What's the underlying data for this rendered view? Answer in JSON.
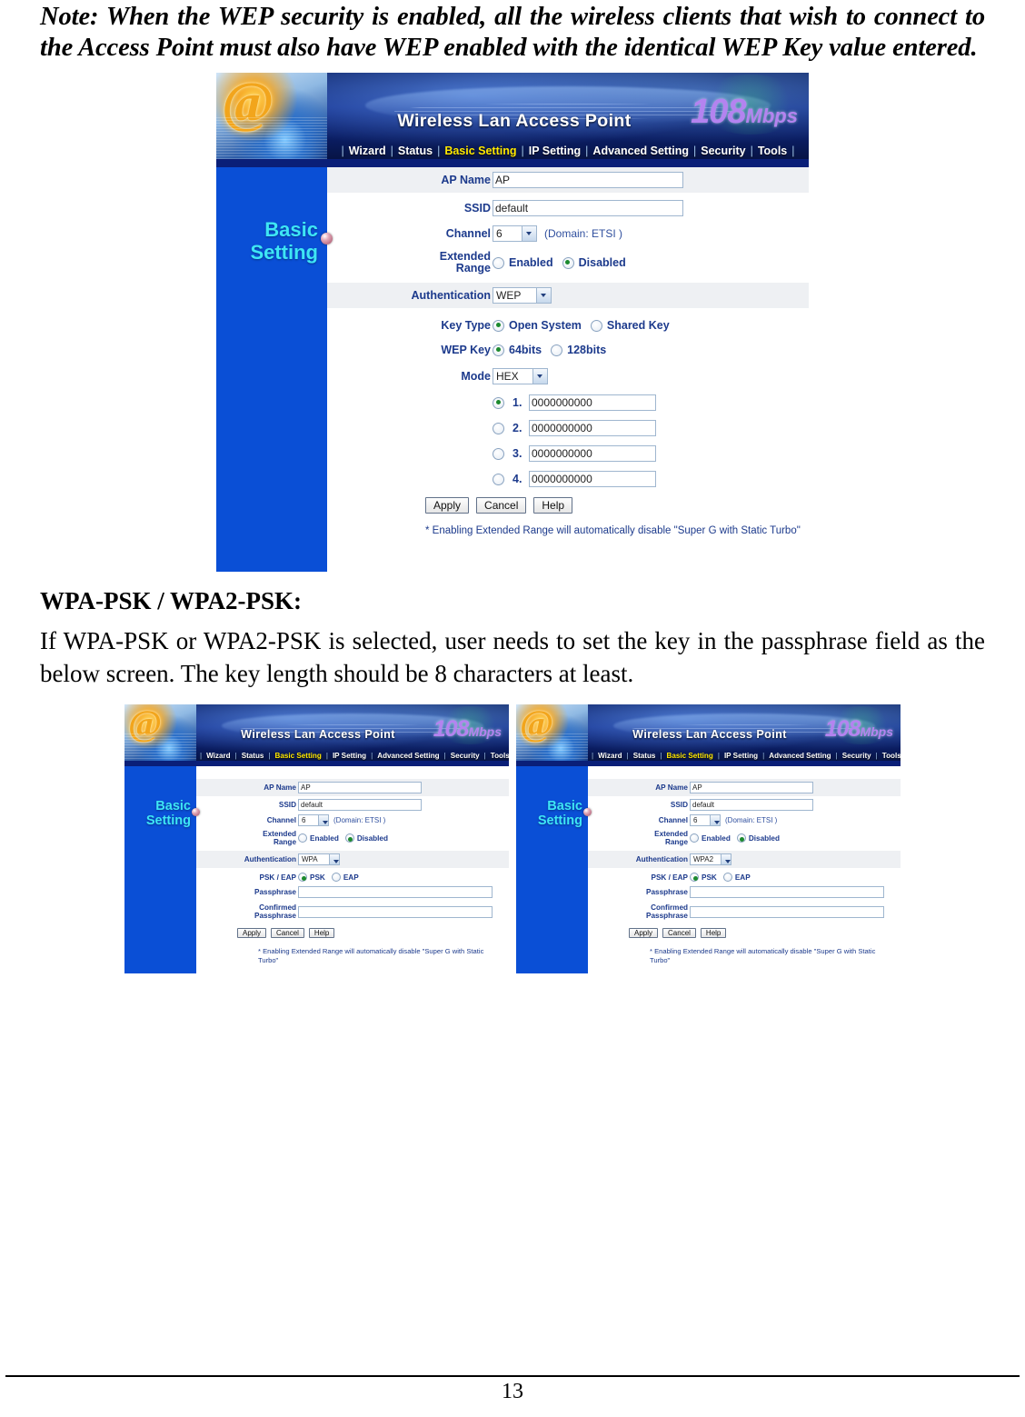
{
  "document": {
    "note": "Note: When the WEP security is enabled, all the wireless clients that wish to connect to the Access Point must also have WEP enabled with the identical WEP Key value entered.",
    "heading_wpa": "WPA-PSK / WPA2-PSK:",
    "paragraph_wpa": "If WPA-PSK or WPA2-PSK is selected, user needs to set the key in the passphrase field as the below screen. The key length should be 8 characters at least.",
    "page_number": "13"
  },
  "banner": {
    "product_title": "Wireless Lan Access Point",
    "speed_number": "108",
    "speed_unit": "Mbps",
    "logo_glyph": "@"
  },
  "nav": {
    "items": [
      {
        "label": "Wizard",
        "active": false
      },
      {
        "label": "Status",
        "active": false
      },
      {
        "label": "Basic Setting",
        "active": true
      },
      {
        "label": "IP Setting",
        "active": false
      },
      {
        "label": "Advanced Setting",
        "active": false
      },
      {
        "label": "Security",
        "active": false
      },
      {
        "label": "Tools",
        "active": false
      }
    ],
    "separator": "|"
  },
  "sidebar": {
    "label": "Basic\nSetting"
  },
  "labels": {
    "ap_name": "AP Name",
    "ssid": "SSID",
    "channel": "Channel",
    "extended_range": "Extended\nRange",
    "authentication": "Authentication",
    "key_type": "Key Type",
    "wep_key": "WEP Key",
    "mode": "Mode",
    "psk_eap": "PSK / EAP",
    "passphrase": "Passphrase",
    "confirmed_passphrase": "Confirmed\nPassphrase"
  },
  "options": {
    "enabled": "Enabled",
    "disabled": "Disabled",
    "open_system": "Open System",
    "shared_key": "Shared Key",
    "bits64": "64bits",
    "bits128": "128bits",
    "psk": "PSK",
    "eap": "EAP"
  },
  "buttons": {
    "apply": "Apply",
    "cancel": "Cancel",
    "help": "Help"
  },
  "footnote": "* Enabling Extended Range will automatically disable \"Super G with Static Turbo\"",
  "screens": {
    "wep": {
      "ap_name_value": "AP",
      "ssid_value": "default",
      "channel_value": "6",
      "domain_hint": "(Domain: ETSI )",
      "extended_range_enabled_selected": false,
      "extended_range_disabled_selected": true,
      "authentication_value": "WEP",
      "key_type_open_selected": true,
      "key_type_shared_selected": false,
      "wep_key_64_selected": true,
      "wep_key_128_selected": false,
      "mode_value": "HEX",
      "keys": [
        {
          "index": "1.",
          "value": "0000000000",
          "selected": true
        },
        {
          "index": "2.",
          "value": "0000000000",
          "selected": false
        },
        {
          "index": "3.",
          "value": "0000000000",
          "selected": false
        },
        {
          "index": "4.",
          "value": "0000000000",
          "selected": false
        }
      ]
    },
    "wpa": {
      "ap_name_value": "AP",
      "ssid_value": "default",
      "channel_value": "6",
      "domain_hint": "(Domain: ETSI )",
      "extended_range_enabled_selected": false,
      "extended_range_disabled_selected": true,
      "authentication_value": "WPA",
      "psk_selected": true,
      "eap_selected": false,
      "passphrase_value": "",
      "confirmed_passphrase_value": ""
    },
    "wpa2": {
      "ap_name_value": "AP",
      "ssid_value": "default",
      "channel_value": "6",
      "domain_hint": "(Domain: ETSI )",
      "extended_range_enabled_selected": false,
      "extended_range_disabled_selected": true,
      "authentication_value": "WPA2",
      "psk_selected": true,
      "eap_selected": false,
      "passphrase_value": "",
      "confirmed_passphrase_value": ""
    }
  },
  "colors": {
    "nav_active": "#ffe800",
    "sidebar_bg": "#0a4fd6",
    "sidebar_text": "#3ee6f5",
    "label_text": "#1c3a8c",
    "banner_bg": "#0b1f63",
    "speed_text": "#b483f0"
  }
}
